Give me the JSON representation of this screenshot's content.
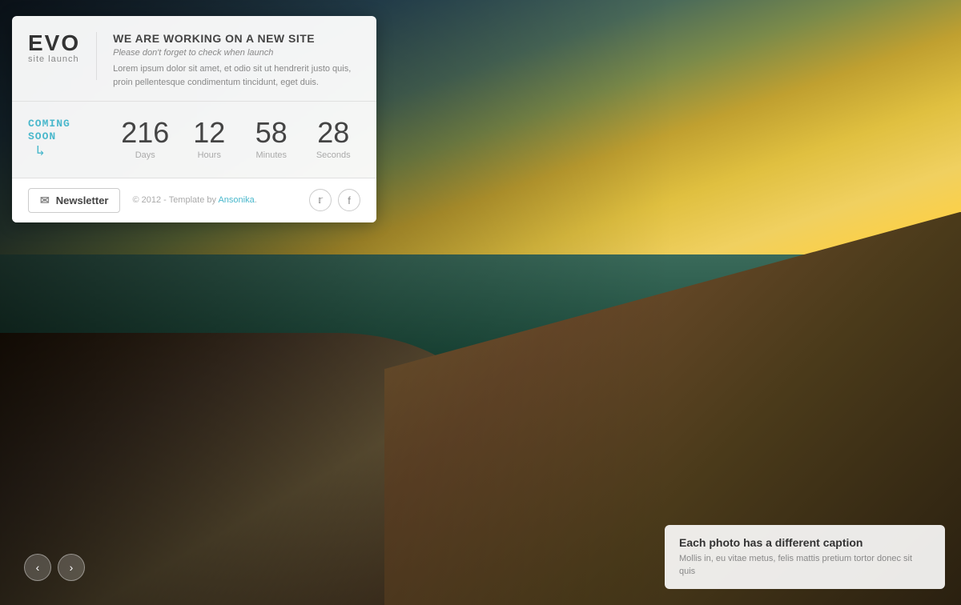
{
  "background": {
    "alt": "Sunset over water with wooden boardwalk"
  },
  "panel": {
    "logo": {
      "brand": "EVO",
      "subtitle": "site launch"
    },
    "header": {
      "title": "WE ARE WORKING ON A NEW SITE",
      "subtitle": "Please don't forget to check when launch",
      "description": "Lorem ipsum dolor sit amet, et odio sit ut hendrerit justo quis, proin pellentesque condimentum tincidunt, eget duis."
    },
    "countdown": {
      "coming_soon_line1": "COMING",
      "coming_soon_line2": "SOON",
      "arrow": "↳",
      "units": [
        {
          "number": "216",
          "label": "Days"
        },
        {
          "number": "12",
          "label": "Hours"
        },
        {
          "number": "58",
          "label": "Minutes"
        },
        {
          "number": "28",
          "label": "Seconds"
        }
      ]
    },
    "footer": {
      "newsletter_label": "Newsletter",
      "copyright": "© 2012 - Template by ",
      "author": "Ansonika",
      "author_suffix": "."
    }
  },
  "caption": {
    "title": "Each photo has a different caption",
    "text": "Mollis in, eu vitae metus, felis mattis pretium tortor donec sit quis"
  },
  "nav": {
    "prev": "‹",
    "next": "›"
  },
  "social": {
    "twitter": "t",
    "facebook": "f"
  }
}
